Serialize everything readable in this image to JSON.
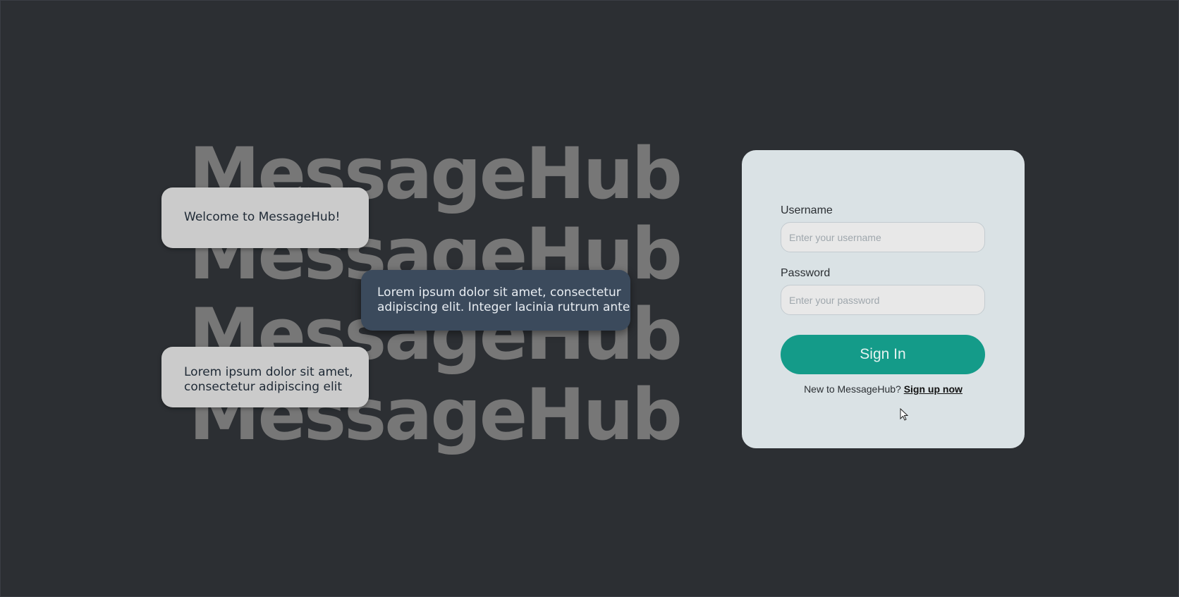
{
  "background": {
    "brand_words": [
      "MessageHub",
      "MessageHub",
      "MessageHub",
      "MessageHub"
    ]
  },
  "bubbles": [
    {
      "text": "Welcome to MessageHub!"
    },
    {
      "text": "Lorem ipsum dolor sit amet, consectetur\nadipiscing elit. Integer lacinia rutrum ante"
    },
    {
      "text": "Lorem ipsum dolor sit amet,\nconsectetur adipiscing elit"
    }
  ],
  "login": {
    "username_label": "Username",
    "username_placeholder": "Enter your username",
    "username_value": "",
    "password_label": "Password",
    "password_placeholder": "Enter your password",
    "password_value": "",
    "signin_label": "Sign In",
    "signup_prompt": "New to MessageHub?",
    "signup_link": "Sign up now"
  },
  "colors": {
    "page_background": "#2c2f33",
    "card_background": "#dae2e5",
    "accent": "#149b89",
    "dark_bubble": "#3b4a5c",
    "light_bubble": "#cbcbcb"
  },
  "icons": {
    "cursor": "mouse-pointer-icon"
  }
}
